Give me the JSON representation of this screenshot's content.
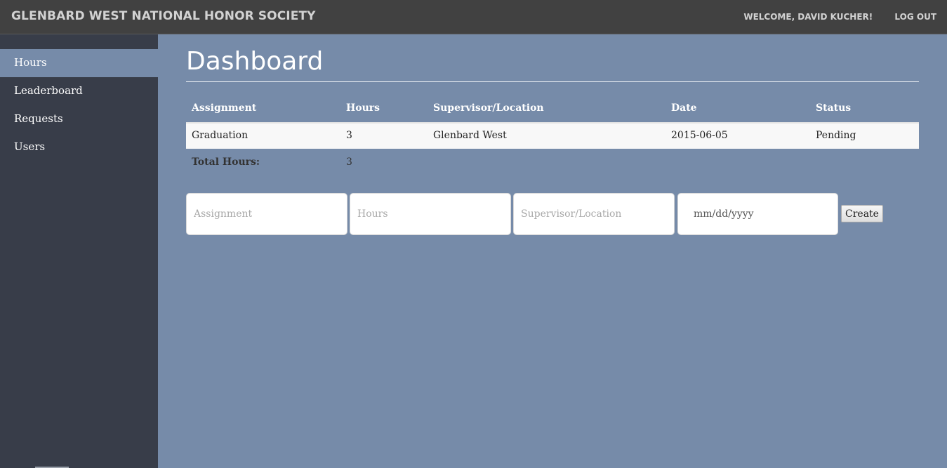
{
  "header": {
    "brand": "GLENBARD WEST NATIONAL HONOR SOCIETY",
    "welcome": "WELCOME, DAVID KUCHER!",
    "logout": "LOG OUT"
  },
  "sidebar": {
    "items": [
      {
        "label": "Hours",
        "active": true
      },
      {
        "label": "Leaderboard",
        "active": false
      },
      {
        "label": "Requests",
        "active": false
      },
      {
        "label": "Users",
        "active": false
      }
    ]
  },
  "main": {
    "title": "Dashboard",
    "table": {
      "columns": [
        "Assignment",
        "Hours",
        "Supervisor/Location",
        "Date",
        "Status"
      ],
      "rows": [
        [
          "Graduation",
          "3",
          "Glenbard West",
          "2015-06-05",
          "Pending"
        ]
      ],
      "total_label": "Total Hours:",
      "total_value": "3"
    },
    "form": {
      "assignment_placeholder": "Assignment",
      "hours_placeholder": "Hours",
      "supervisor_placeholder": "Supervisor/Location",
      "date_placeholder": "mm/dd/yyyy",
      "create_label": "Create"
    }
  },
  "colors": {
    "topbar": "#414141",
    "sidebar": "#383d49",
    "accent": "#768ba9",
    "text_light": "#ffffff"
  }
}
